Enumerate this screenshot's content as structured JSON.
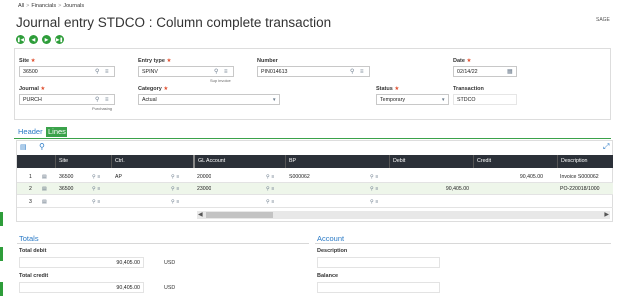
{
  "breadcrumb": [
    "All",
    "Financials",
    "Journals"
  ],
  "title": "Journal entry STDCO : Column complete transaction",
  "brand": "SAGE",
  "nav_buttons": [
    "first",
    "previous",
    "next",
    "last"
  ],
  "fields": {
    "site": {
      "label": "Site",
      "value": "36500"
    },
    "entry_type": {
      "label": "Entry type",
      "value": "SPINV",
      "sub": "Sup invoice"
    },
    "number": {
      "label": "Number",
      "value": "PIN014613"
    },
    "date": {
      "label": "Date",
      "value": "02/14/22"
    },
    "journal": {
      "label": "Journal",
      "value": "PURCH",
      "sub": "Purchasing"
    },
    "category": {
      "label": "Category",
      "value": "Actual"
    },
    "status": {
      "label": "Status",
      "value": "Temporary"
    },
    "transaction": {
      "label": "Transaction",
      "value": "STDCO"
    }
  },
  "tabs": {
    "header": "Header",
    "lines": "Lines"
  },
  "grid": {
    "columns": [
      "Site",
      "Ctrl.",
      "GL Account",
      "BP",
      "Debit",
      "Credit",
      "Description"
    ],
    "rows": [
      {
        "num": "1",
        "site": "36500",
        "ctrl": "AP",
        "gl": "20000",
        "bp": "S000062",
        "debit": "",
        "credit": "90,405.00",
        "desc": "Invoice S000062"
      },
      {
        "num": "2",
        "site": "36500",
        "ctrl": "",
        "gl": "23000",
        "bp": "",
        "debit": "90,405.00",
        "credit": "",
        "desc": "PO-220018/1000"
      },
      {
        "num": "3",
        "site": "",
        "ctrl": "",
        "gl": "",
        "bp": "",
        "debit": "",
        "credit": "",
        "desc": ""
      }
    ]
  },
  "totals": {
    "title": "Totals",
    "debit_label": "Total debit",
    "debit_value": "90,405.00",
    "credit_label": "Total credit",
    "credit_value": "90,405.00",
    "currency": "USD"
  },
  "account": {
    "title": "Account",
    "description_label": "Description",
    "balance_label": "Balance"
  }
}
